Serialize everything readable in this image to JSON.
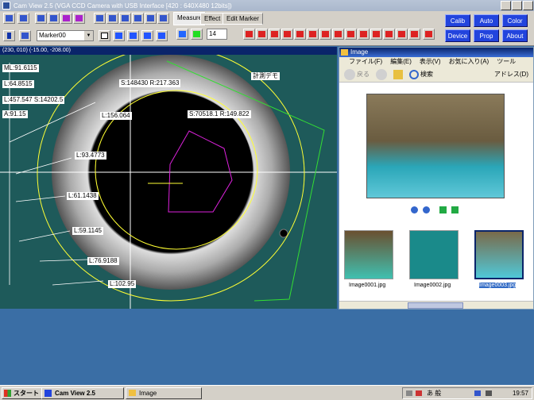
{
  "window": {
    "title": "Cam View 2.5 (VGA CCD Camera with USB Interface [420 : 640X480 12bits])"
  },
  "toolbar": {
    "marker_select": "Marker00",
    "font_size": "14",
    "tabs": [
      "Measure",
      "Effect",
      "Edit Marker"
    ],
    "buttons": [
      "Calib",
      "Auto",
      "Color",
      "Device",
      "Prop",
      "About"
    ]
  },
  "viewer": {
    "coords": "(230, 010)  (-15.00, -208.00)",
    "labels": {
      "ml": "ML:91.6115",
      "l1": "L:64.8515",
      "l2": "L:457.547 S:14202.5",
      "a": "A:91.15",
      "s1": "S:148430 R:217.363",
      "s2": "S:70518.1 R:149.822",
      "l3": "L:156.064",
      "l4": "L:93.4773",
      "l5": "L:61.1438",
      "l6": "L:59.1145",
      "l7": "L:76.9188",
      "l8": "L:102.95",
      "demo": "計測デモ"
    }
  },
  "explorer": {
    "title": "Image",
    "menu": [
      "ファイル(F)",
      "編集(E)",
      "表示(V)",
      "お気に入り(A)",
      "ツール"
    ],
    "back": "戻る",
    "search": "検索",
    "address": "アドレス(D)",
    "files": [
      "Image0001.jpg",
      "Image0002.jpg",
      "Image0003.jpg"
    ]
  },
  "taskbar": {
    "start": "スタート",
    "tasks": [
      "Cam View 2.5",
      "Image"
    ],
    "ime": "あ 般",
    "clock": "19:57"
  },
  "colors": {
    "accent": "#2244dd",
    "titlebar": "#0a246a",
    "measure_yellow": "#ffff33",
    "measure_green": "#33dd33",
    "measure_magenta": "#dd22dd"
  }
}
